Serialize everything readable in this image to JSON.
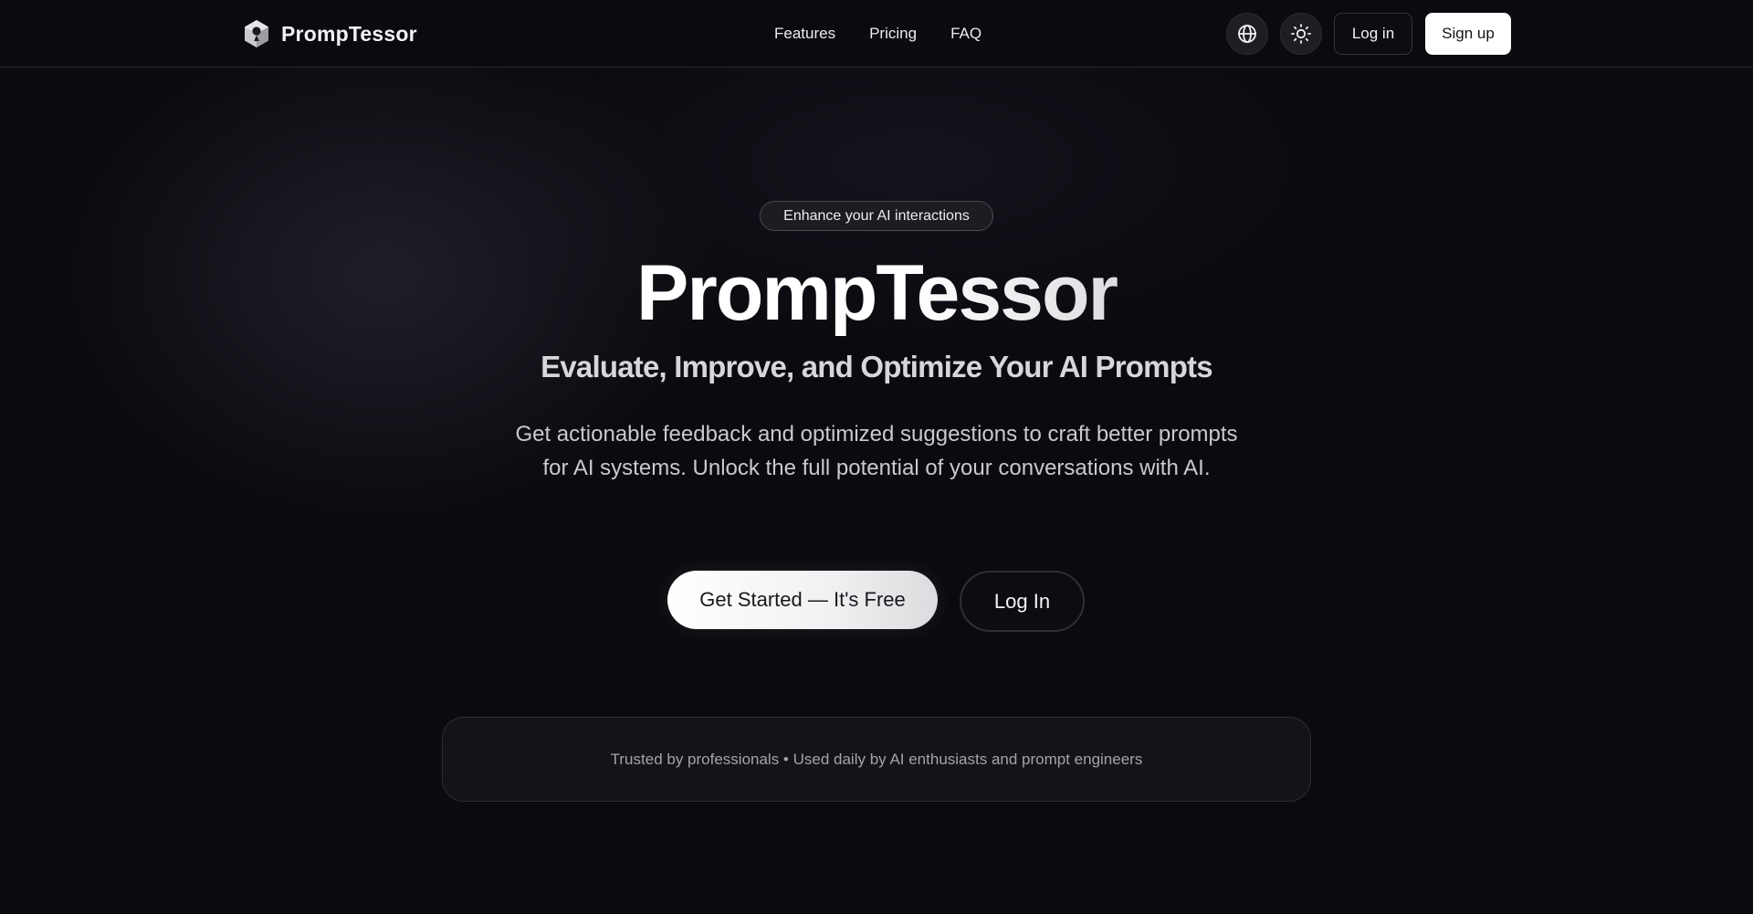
{
  "header": {
    "brand_name": "PrompTessor",
    "nav": [
      {
        "label": "Features"
      },
      {
        "label": "Pricing"
      },
      {
        "label": "FAQ"
      }
    ],
    "icons": {
      "language": "globe-icon",
      "theme": "sun-icon",
      "logo": "hexagon-logo-icon"
    },
    "login_label": "Log in",
    "signup_label": "Sign up"
  },
  "hero": {
    "badge": "Enhance your AI interactions",
    "title": "PrompTessor",
    "subtitle": "Evaluate, Improve, and Optimize Your AI Prompts",
    "description": "Get actionable feedback and optimized suggestions to craft better prompts for AI systems. Unlock the full potential of your conversations with AI.",
    "cta_primary": "Get Started — It's Free",
    "cta_secondary": "Log In"
  },
  "trust": {
    "text": "Trusted by professionals • Used daily by AI enthusiasts and prompt engineers"
  },
  "colors": {
    "background": "#0b0a0e",
    "text_primary": "#ffffff",
    "text_muted": "#a3a3aa",
    "border": "#2d2c32"
  }
}
